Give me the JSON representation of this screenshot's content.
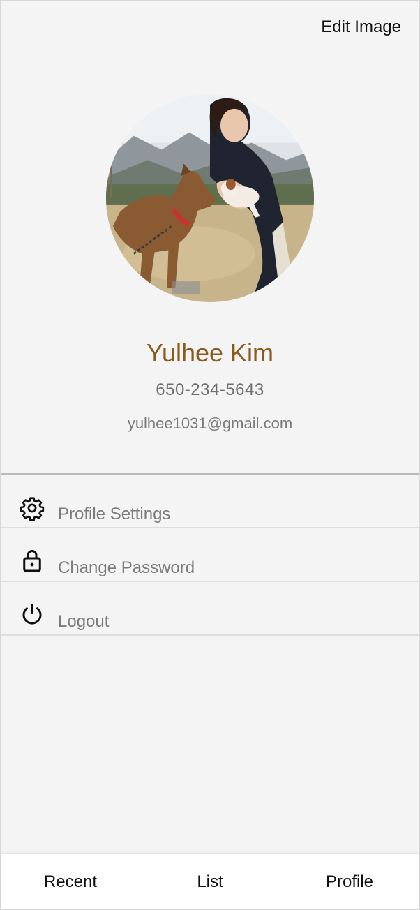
{
  "header": {
    "edit_image_label": "Edit Image"
  },
  "profile": {
    "name": "Yulhee Kim",
    "phone": "650-234-5643",
    "email": "yulhee1031@gmail.com"
  },
  "menu": {
    "items": [
      {
        "label": "Profile Settings",
        "icon": "gear-icon"
      },
      {
        "label": "Change Password",
        "icon": "lock-icon"
      },
      {
        "label": "Logout",
        "icon": "power-icon"
      }
    ]
  },
  "tabs": [
    {
      "label": "Recent"
    },
    {
      "label": "List"
    },
    {
      "label": "Profile"
    }
  ],
  "colors": {
    "name_color": "#8b5a1e",
    "background": "#f4f4f4"
  }
}
